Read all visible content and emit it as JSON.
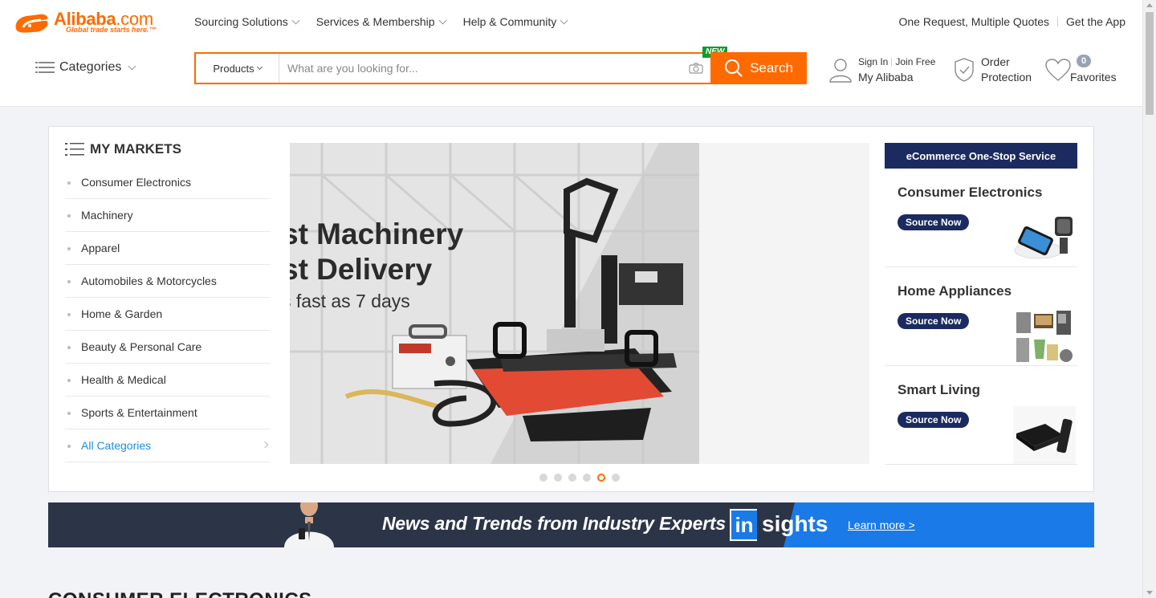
{
  "brand": {
    "logo_text": "Alibaba",
    "logo_suffix": ".com",
    "tagline": "Global trade starts here.™",
    "accent": "#ff6a00",
    "navy": "#1b2b5f"
  },
  "topnav": {
    "sourcing": "Sourcing Solutions",
    "services": "Services & Membership",
    "help": "Help & Community",
    "one_request": "One Request, Multiple Quotes",
    "get_app": "Get the App"
  },
  "categories_label": "Categories",
  "search": {
    "category": "Products",
    "placeholder": "What are you looking for...",
    "button": "Search",
    "badge": "NEW"
  },
  "user": {
    "sign_in": "Sign In",
    "join": "Join Free",
    "my_alibaba": "My Alibaba",
    "order_line1": "Order",
    "order_line2": "Protection",
    "favorites_count": "0",
    "favorites": "Favorites"
  },
  "markets": {
    "title": "MY MARKETS",
    "items": [
      "Consumer Electronics",
      "Machinery",
      "Apparel",
      "Automobiles & Motorcycles",
      "Home & Garden",
      "Beauty & Personal Care",
      "Health & Medical",
      "Sports & Entertainment"
    ],
    "all": "All Categories"
  },
  "banner": {
    "line1": "st Machinery",
    "line2": "st Delivery",
    "line3": "s fast as 7 days",
    "slides": 6,
    "active_slide": 5
  },
  "ecommerce": {
    "title": "eCommerce One-Stop Service",
    "items": [
      {
        "title": "Consumer Electronics",
        "button": "Source Now",
        "icon": "smartphone-charger-icon"
      },
      {
        "title": "Home Appliances",
        "button": "Source Now",
        "icon": "kitchen-appliances-icon"
      },
      {
        "title": "Smart Living",
        "button": "Source Now",
        "icon": "tv-box-icon"
      }
    ]
  },
  "insights": {
    "headline": "News and Trends from Industry Experts",
    "logo_in": "in",
    "logo_sights": "sights",
    "learn_more": "Learn more >"
  },
  "section_title": "CONSUMER ELECTRONICS"
}
